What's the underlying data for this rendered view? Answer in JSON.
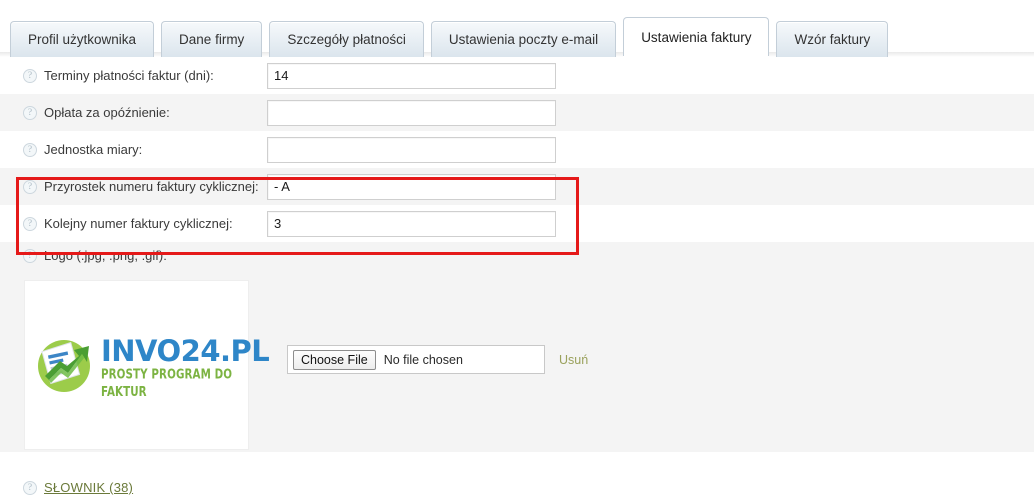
{
  "tabs": [
    {
      "label": "Profil użytkownika",
      "active": false
    },
    {
      "label": "Dane firmy",
      "active": false
    },
    {
      "label": "Szczegóły płatności",
      "active": false
    },
    {
      "label": "Ustawienia poczty e-mail",
      "active": false
    },
    {
      "label": "Ustawienia faktury",
      "active": true
    },
    {
      "label": "Wzór faktury",
      "active": false
    }
  ],
  "help_icon": "?",
  "rows": [
    {
      "label": "Terminy płatności faktur (dni):",
      "value": "14",
      "placeholder": ""
    },
    {
      "label": "Opłata za opóźnienie:",
      "value": "",
      "placeholder": ""
    },
    {
      "label": "Jednostka miary:",
      "value": "",
      "placeholder": ""
    },
    {
      "label": "Przyrostek numeru faktury cyklicznej:",
      "value": "- A",
      "placeholder": ""
    },
    {
      "label": "Kolejny numer faktury cyklicznej:",
      "value": "3",
      "placeholder": ""
    }
  ],
  "logo_section": {
    "label": "Logo (.jpg, .png, .gif):",
    "logo_name": "INVO24.PL",
    "logo_tagline": "PROSTY PROGRAM DO FAKTUR",
    "choose_file_label": "Choose File",
    "no_file_label": "No file chosen",
    "remove_label": "Usuń"
  },
  "footer": {
    "dictionary_link": "SŁOWNIK (38)"
  },
  "colors": {
    "highlight_border": "#e51919",
    "link": "#6b7a3a",
    "logo_blue": "#2e86c8",
    "logo_green": "#7cb342",
    "row_alt": "#f4f4f4",
    "tab_border": "#c3ced8"
  }
}
